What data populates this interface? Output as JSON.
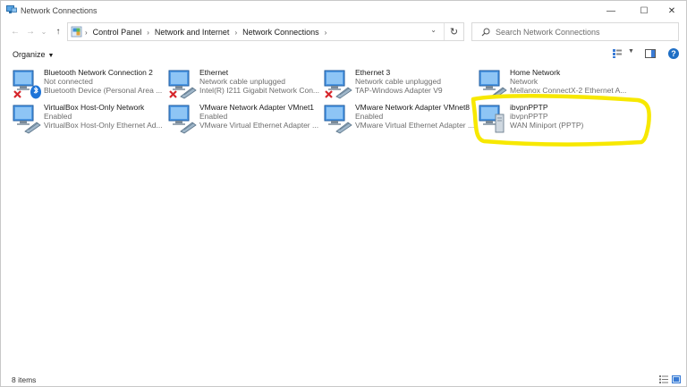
{
  "window": {
    "title": "Network Connections",
    "controls": {
      "minimize": "—",
      "maximize": "☐",
      "close": "✕"
    }
  },
  "nav": {
    "back": "←",
    "forward": "→",
    "up": "↑"
  },
  "breadcrumb": [
    "Control Panel",
    "Network and Internet",
    "Network Connections"
  ],
  "search": {
    "placeholder": "Search Network Connections"
  },
  "toolbar": {
    "organize_label": "Organize"
  },
  "connections": [
    {
      "name": "Bluetooth Network Connection 2",
      "status": "Not connected",
      "adapter": "Bluetooth Device (Personal Area ...",
      "badge": "bluetooth",
      "disabled_x": true
    },
    {
      "name": "Ethernet",
      "status": "Network cable unplugged",
      "adapter": "Intel(R) I211 Gigabit Network Con...",
      "badge": "cable",
      "disabled_x": true
    },
    {
      "name": "Ethernet 3",
      "status": "Network cable unplugged",
      "adapter": "TAP-Windows Adapter V9",
      "badge": "cable",
      "disabled_x": true
    },
    {
      "name": "Home Network",
      "status": "Network",
      "adapter": "Mellanox ConnectX-2 Ethernet A...",
      "badge": "cable",
      "disabled_x": false
    },
    {
      "name": "VirtualBox Host-Only Network",
      "status": "Enabled",
      "adapter": "VirtualBox Host-Only Ethernet Ad...",
      "badge": "cable",
      "disabled_x": false
    },
    {
      "name": "VMware Network Adapter VMnet1",
      "status": "Enabled",
      "adapter": "VMware Virtual Ethernet Adapter ...",
      "badge": "cable",
      "disabled_x": false
    },
    {
      "name": "VMware Network Adapter VMnet8",
      "status": "Enabled",
      "adapter": "VMware Virtual Ethernet Adapter ...",
      "badge": "cable",
      "disabled_x": false
    },
    {
      "name": "ibvpnPPTP",
      "status": "ibvpnPPTP",
      "adapter": "WAN Miniport (PPTP)",
      "badge": "vpn",
      "disabled_x": false
    }
  ],
  "status_bar": {
    "item_count": "8 items"
  },
  "colors": {
    "highlight": "#f7e800",
    "accent": "#1f6fc5",
    "secondary_text": "#6d6d6d"
  }
}
